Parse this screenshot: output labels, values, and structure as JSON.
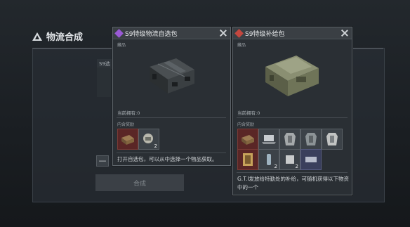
{
  "background": {
    "title": "物流合成",
    "label": "S9选",
    "minus": "—",
    "button": "合成"
  },
  "card1": {
    "title": "S9特级物流自选包",
    "tag": "藏品",
    "owned": "当前拥有:0",
    "contents_label": "内含奖励",
    "items": [
      {
        "icon": "crate-item-icon",
        "qty": ""
      },
      {
        "icon": "helmet-item-icon",
        "qty": "2"
      }
    ],
    "description": "打开自选包，可以从中选择一个物品获取。"
  },
  "card2": {
    "title": "S9特级补给包",
    "tag": "藏品",
    "owned": "当前拥有:0",
    "contents_label": "内含奖励",
    "items": [
      {
        "icon": "crate-item-icon",
        "qty": ""
      },
      {
        "icon": "frame-item-icon",
        "qty": ""
      },
      {
        "icon": "laptop-item-icon",
        "qty": ""
      },
      {
        "icon": "armor-item-icon",
        "qty": ""
      },
      {
        "icon": "armor-item-icon",
        "qty": ""
      },
      {
        "icon": "armor-item-icon",
        "qty": ""
      },
      {
        "icon": "bottle-item-icon",
        "qty": "2"
      },
      {
        "icon": "cup-item-icon",
        "qty": "2"
      },
      {
        "icon": "gear-item-icon",
        "qty": ""
      }
    ],
    "description": "G.T.I发放给特勤处的补给，可随机获得以下物资中的一个"
  }
}
